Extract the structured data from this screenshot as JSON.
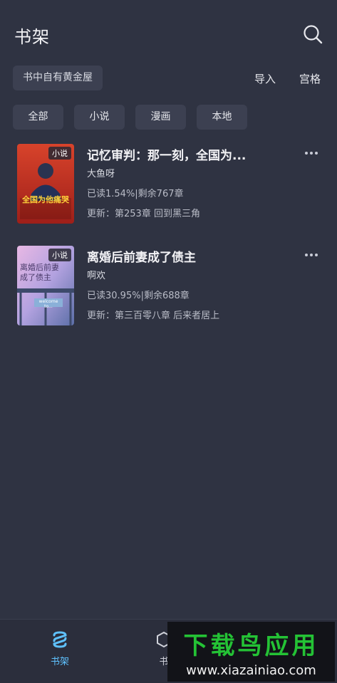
{
  "header": {
    "title": "书架",
    "search_icon": "search-icon"
  },
  "toolbar": {
    "quote": "书中自有黄金屋",
    "import_label": "导入",
    "grid_label": "宫格"
  },
  "filters": [
    {
      "label": "全部"
    },
    {
      "label": "小说"
    },
    {
      "label": "漫画"
    },
    {
      "label": "本地"
    }
  ],
  "books": [
    {
      "title": "记忆审判：那一刻，全国为...",
      "author": "大鱼呀",
      "progress": "已读1.54%|剩余767章",
      "update": "更新：第253章 回到黑三角",
      "cover_tag": "小说",
      "cover_text": "全国为他痛哭",
      "more_icon": "more-dots-icon"
    },
    {
      "title": "离婚后前妻成了债主",
      "author": "啊欢",
      "progress": "已读30.95%|剩余688章",
      "update": "更新：第三百零八章 后来者居上",
      "cover_tag": "小说",
      "cover_text": "离婚后前妻成了债主",
      "cover_sign": "welcome to...",
      "more_icon": "more-dots-icon"
    }
  ],
  "bottom_nav": {
    "shelf_label": "书架",
    "store_label": "书"
  },
  "watermark": {
    "title": "下载鸟应用",
    "url": "www.xiazainiao.com"
  },
  "colors": {
    "background": "#2f3342",
    "chip": "#3c4051",
    "active_nav": "#5fc2ff",
    "watermark_green": "#24c235"
  }
}
